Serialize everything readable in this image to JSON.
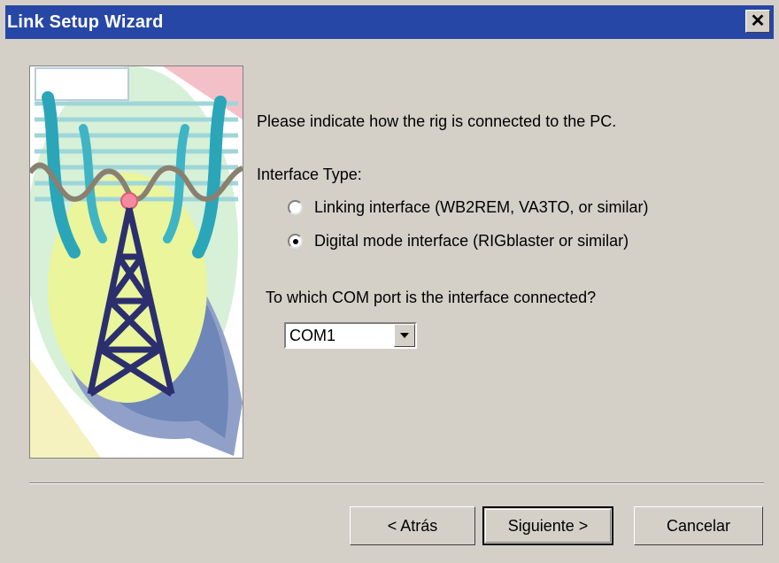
{
  "window": {
    "title": "Link Setup Wizard",
    "close_icon": "close-icon"
  },
  "content": {
    "prompt": "Please indicate how the rig is connected to the PC.",
    "interface_type_label": "Interface Type:",
    "options": [
      {
        "label": "Linking interface (WB2REM, VA3TO, or similar)",
        "selected": false
      },
      {
        "label": "Digital mode interface (RIGblaster or similar)",
        "selected": true
      }
    ],
    "com_port_question": "To which COM port is the interface connected?",
    "com_port": {
      "selected": "COM1"
    }
  },
  "buttons": {
    "back": "< Atrás",
    "next": "Siguiente >",
    "cancel": "Cancelar"
  },
  "colors": {
    "titlebar": "#2747a6",
    "dialog_bg": "#d4d0c8",
    "tower": "#2b2f6e"
  }
}
